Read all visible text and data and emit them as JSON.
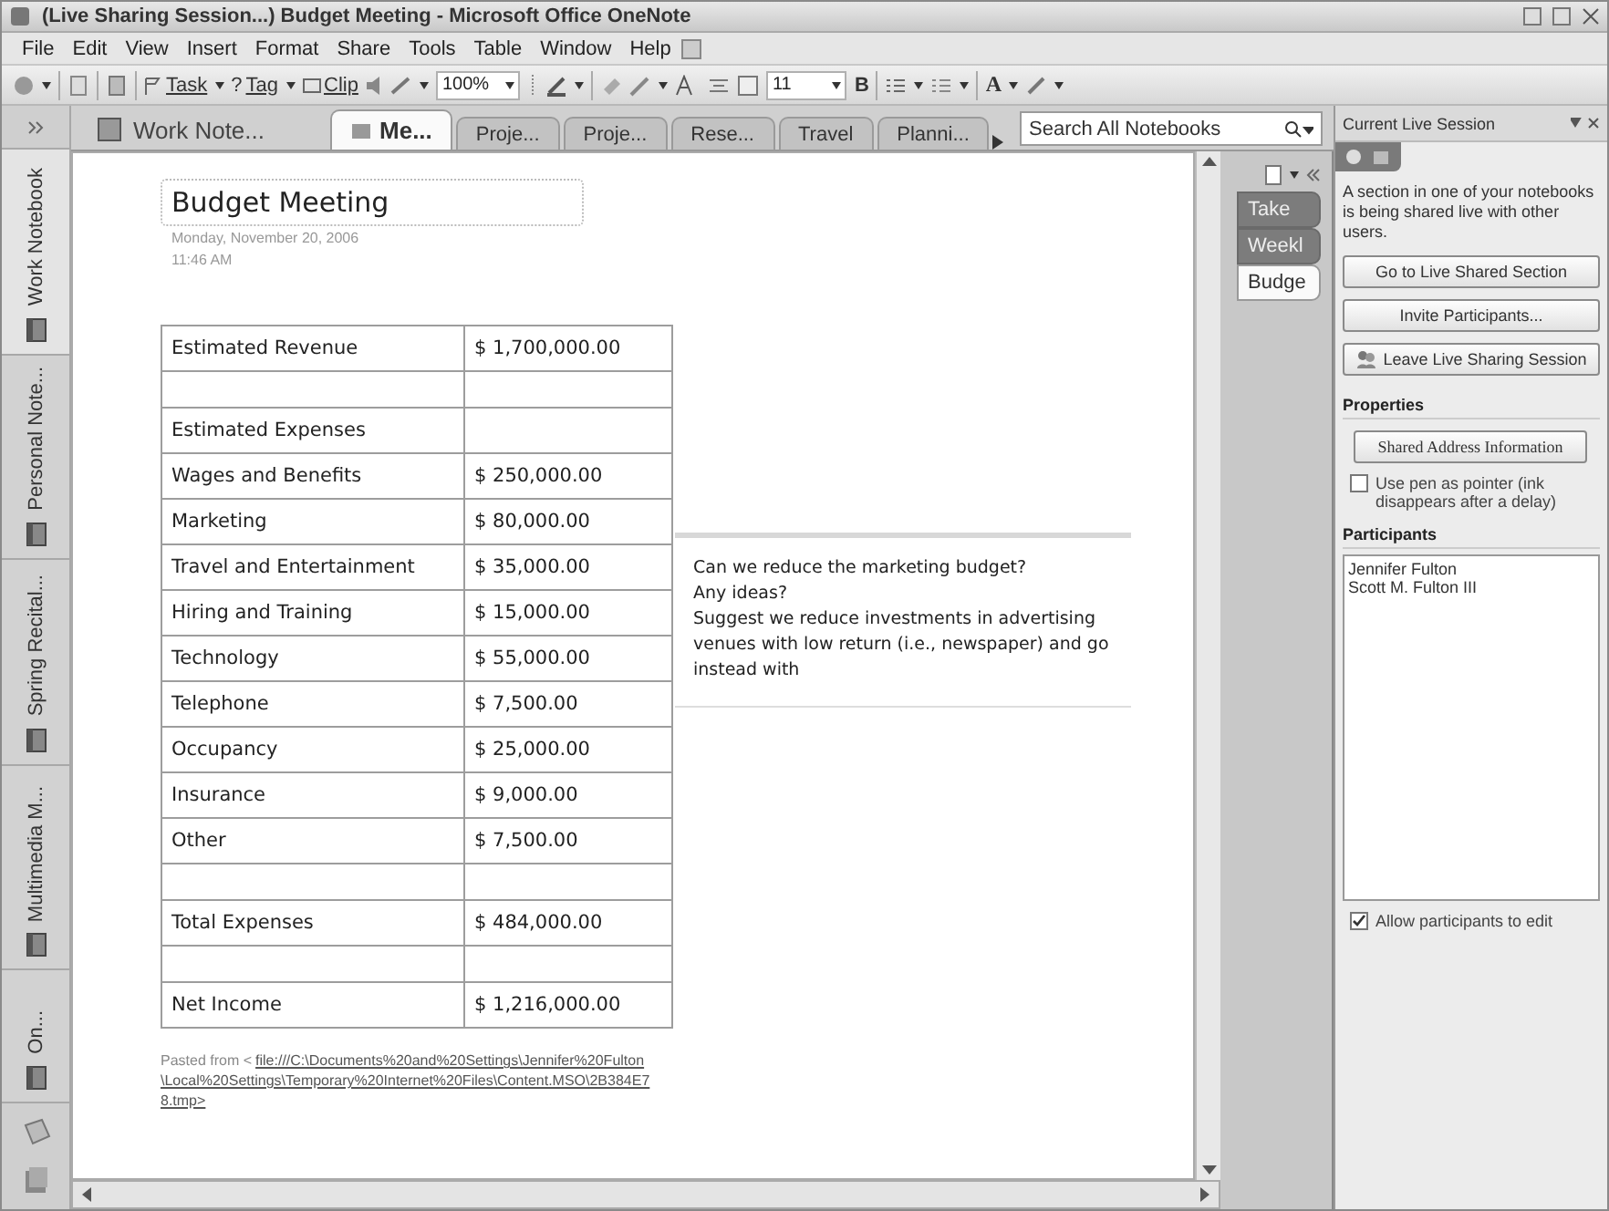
{
  "window": {
    "title": "(Live Sharing Session...) Budget Meeting - Microsoft Office OneNote"
  },
  "menu": [
    "File",
    "Edit",
    "View",
    "Insert",
    "Format",
    "Share",
    "Tools",
    "Table",
    "Window",
    "Help"
  ],
  "toolbar": {
    "task": "Task",
    "tag_mark": "?",
    "tag": "Tag",
    "clip": "Clip",
    "zoom": "100%",
    "font_size": "11",
    "bold": "B",
    "font_color": "A"
  },
  "notebooks": [
    {
      "label": "Work Notebook",
      "selected": true
    },
    {
      "label": "Personal Note...",
      "selected": false
    },
    {
      "label": "Spring Recital...",
      "selected": false
    },
    {
      "label": "Multimedia M...",
      "selected": false
    },
    {
      "label": "On...",
      "selected": false
    }
  ],
  "notebook_name": "Work Note...",
  "sections": [
    {
      "label": "Me...",
      "selected": true
    },
    {
      "label": "Proje...",
      "selected": false
    },
    {
      "label": "Proje...",
      "selected": false
    },
    {
      "label": "Rese...",
      "selected": false
    },
    {
      "label": "Travel",
      "selected": false
    },
    {
      "label": "Planni...",
      "selected": false
    }
  ],
  "search": {
    "placeholder": "Search All Notebooks"
  },
  "page": {
    "title": "Budget Meeting",
    "date": "Monday, November 20, 2006",
    "time": "11:46 AM",
    "table": [
      {
        "kind": "row",
        "label": "Estimated Revenue",
        "value": "$ 1,700,000.00"
      },
      {
        "kind": "blank"
      },
      {
        "kind": "heading",
        "label": "Estimated Expenses"
      },
      {
        "kind": "row",
        "label": "Wages and Benefits",
        "value": "$ 250,000.00"
      },
      {
        "kind": "row",
        "label": "Marketing",
        "value": "$ 80,000.00"
      },
      {
        "kind": "row",
        "label": "Travel and Entertainment",
        "value": "$ 35,000.00"
      },
      {
        "kind": "row",
        "label": "Hiring and Training",
        "value": "$ 15,000.00"
      },
      {
        "kind": "row",
        "label": "Technology",
        "value": "$ 55,000.00"
      },
      {
        "kind": "row",
        "label": "Telephone",
        "value": "$ 7,500.00"
      },
      {
        "kind": "row",
        "label": "Occupancy",
        "value": "$ 25,000.00"
      },
      {
        "kind": "row",
        "label": "Insurance",
        "value": "$ 9,000.00"
      },
      {
        "kind": "row",
        "label": "Other",
        "value": "$ 7,500.00"
      },
      {
        "kind": "blank"
      },
      {
        "kind": "row",
        "label": "Total Expenses",
        "value": "$ 484,000.00"
      },
      {
        "kind": "blank"
      },
      {
        "kind": "row",
        "label": "Net Income",
        "value": "$ 1,216,000.00"
      }
    ],
    "note": [
      "Can we reduce the marketing budget?",
      "Any ideas?",
      "Suggest we reduce investments in advertising venues with low return (i.e., newspaper) and go instead with"
    ],
    "pasted_prefix": "Pasted from <",
    "pasted_link": "file:///C:\\Documents%20and%20Settings\\Jennifer%20Fulton\\Local%20Settings\\Temporary%20Internet%20Files\\Content.MSO\\2B384E78.tmp>"
  },
  "page_tabs": [
    {
      "label": "Take",
      "selected": false
    },
    {
      "label": "Weekl",
      "selected": false
    },
    {
      "label": "Budge",
      "selected": true
    }
  ],
  "task_pane": {
    "title": "Current Live Session",
    "intro": "A section in one of your notebooks is being shared live with other users.",
    "buttons": [
      "Go to Live Shared Section",
      "Invite Participants...",
      "Leave Live Sharing Session"
    ],
    "properties_heading": "Properties",
    "address_button": "Shared Address Information",
    "pen_option": {
      "label": "Use pen as pointer (ink disappears after a delay)",
      "checked": false
    },
    "participants_heading": "Participants",
    "participants": [
      "Jennifer Fulton",
      "Scott M. Fulton III"
    ],
    "edit_option": {
      "label": "Allow participants to edit",
      "checked": true
    }
  }
}
